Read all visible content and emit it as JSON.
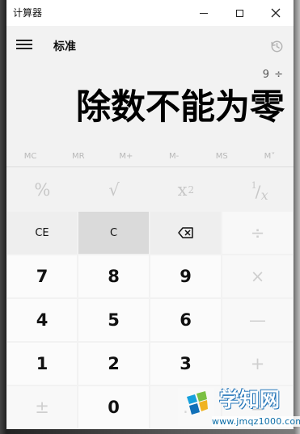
{
  "window": {
    "title": "计算器",
    "controls": {
      "minimize": "minimize-icon",
      "maximize": "maximize-icon",
      "close": "close-icon"
    }
  },
  "header": {
    "mode": "标准",
    "menu_icon": "hamburger-menu-icon",
    "history_icon": "history-icon"
  },
  "display": {
    "expression": "9 ÷",
    "result": "除数不能为零"
  },
  "memory": {
    "buttons": [
      "MC",
      "MR",
      "M+",
      "M-",
      "MS",
      "M˅"
    ]
  },
  "functions": {
    "percent": "%",
    "square_root": "√",
    "square_base": "x",
    "square_power": "2",
    "reciprocal_numerator": "1",
    "reciprocal_slash": "/",
    "reciprocal_denominator": "x"
  },
  "keypad": {
    "ce": "CE",
    "c": "C",
    "backspace": "⌫",
    "divide": "÷",
    "seven": "7",
    "eight": "8",
    "nine": "9",
    "multiply": "×",
    "four": "4",
    "five": "5",
    "six": "6",
    "minus": "—",
    "one": "1",
    "two": "2",
    "three": "3",
    "plus": "+",
    "negate": "±",
    "zero": "0",
    "decimal": ".",
    "equals": "="
  },
  "watermark": {
    "brand": "学知网",
    "url": "www.jmqz1000.com"
  },
  "colors": {
    "window_bg": "#f2f2f2",
    "selected_key": "#dadada",
    "watermark_blue": "#0c6ea8"
  }
}
